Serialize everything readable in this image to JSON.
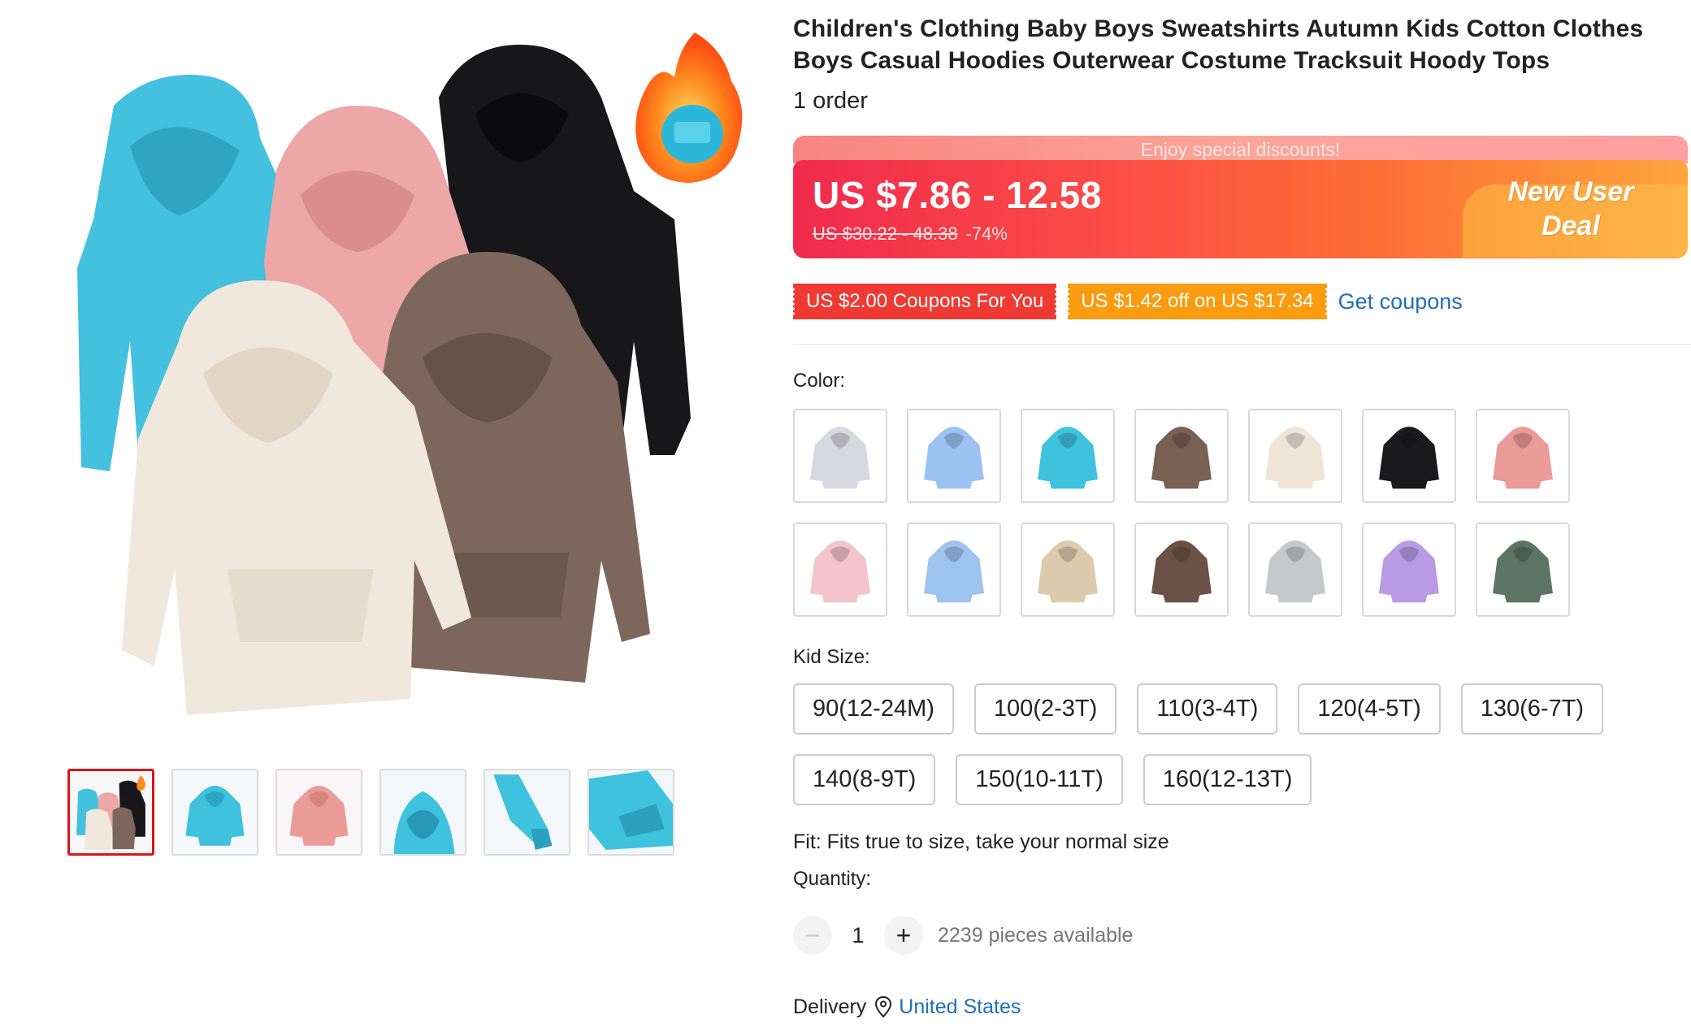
{
  "product": {
    "title": "Children's Clothing Baby Boys Sweatshirts Autumn Kids Cotton Clothes Boys Casual Hoodies Outerwear Costume Tracksuit Hoody Tops",
    "orders": "1 order"
  },
  "price": {
    "banner_text": "Enjoy special discounts!",
    "current": "US $7.86 - 12.58",
    "original": "US $30.22 - 48.38",
    "discount": "-74%",
    "deal_badge": "New User Deal",
    "colors": {
      "red": "#f02a4d",
      "orange": "#fea53c"
    }
  },
  "coupons": {
    "items": [
      "US $2.00 Coupons For You",
      "US $1.42 off on US $17.34"
    ],
    "get_label": "Get coupons"
  },
  "color": {
    "label": "Color:",
    "options": [
      {
        "icon": "hoodie-light-gray",
        "color": "#d8d8e0"
      },
      {
        "icon": "hoodie-light-blue",
        "color": "#9cc2f2"
      },
      {
        "icon": "hoodie-sky-blue",
        "color": "#3ec2de"
      },
      {
        "icon": "hoodie-brown",
        "color": "#7a6053"
      },
      {
        "icon": "hoodie-cream",
        "color": "#efe6d7"
      },
      {
        "icon": "hoodie-black",
        "color": "#1a1a1d"
      },
      {
        "icon": "hoodie-pink",
        "color": "#eb9b98"
      },
      {
        "icon": "hoodie-baby-pink",
        "color": "#f3c4cc"
      },
      {
        "icon": "hoodie-blue",
        "color": "#9ec3ee"
      },
      {
        "icon": "hoodie-khaki",
        "color": "#dccbad"
      },
      {
        "icon": "hoodie-dark-brown",
        "color": "#6c5246"
      },
      {
        "icon": "hoodie-silver",
        "color": "#c6c8cc"
      },
      {
        "icon": "hoodie-lavender",
        "color": "#b99ae4"
      },
      {
        "icon": "hoodie-green",
        "color": "#5c7463"
      }
    ]
  },
  "size": {
    "label": "Kid Size:",
    "options": [
      "90(12-24M)",
      "100(2-3T)",
      "110(3-4T)",
      "120(4-5T)",
      "130(6-7T)",
      "140(8-9T)",
      "150(10-11T)",
      "160(12-13T)"
    ]
  },
  "fit": "Fit: Fits true to size, take your normal size",
  "quantity": {
    "label": "Quantity:",
    "value": "1",
    "minus": "−",
    "plus": "+",
    "available": "2239 pieces available"
  },
  "delivery": {
    "label": "Delivery",
    "country": "United States"
  },
  "gallery": {
    "thumbnails": [
      "group-all-colors",
      "blue-front",
      "pink-front",
      "blue-hood-closeup",
      "blue-cuff-closeup",
      "blue-hem-closeup"
    ],
    "active_index": 0
  }
}
